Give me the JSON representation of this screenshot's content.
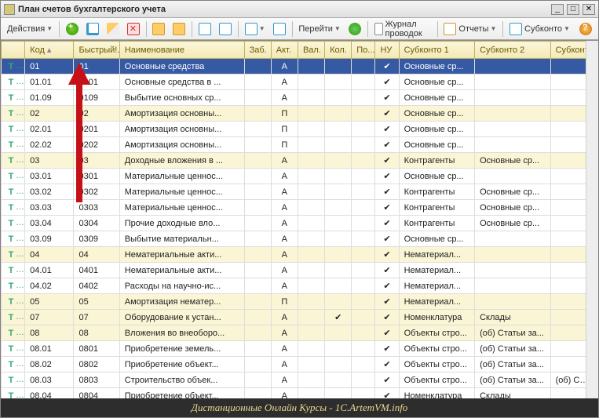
{
  "window": {
    "title": "План счетов бухгалтерского учета"
  },
  "toolbar": {
    "actions": "Действия",
    "go": "Перейти",
    "journal": "Журнал проводок",
    "reports": "Отчеты",
    "subkonto": "Субконто"
  },
  "columns": {
    "code": "Код",
    "fast": "Быстрый!...",
    "name": "Наименование",
    "zab": "Заб.",
    "akt": "Акт.",
    "val": "Вал.",
    "kol": "Кол.",
    "po": "По...",
    "nu": "НУ",
    "s1": "Субконто 1",
    "s2": "Субконто 2",
    "s3": "Субконто"
  },
  "rows": [
    {
      "lvl": 0,
      "sel": true,
      "code": "01",
      "fast": "01",
      "name": "Основные средства",
      "akt": "А",
      "nu": true,
      "s1": "Основные ср...",
      "s2": "",
      "s3": ""
    },
    {
      "lvl": 1,
      "code": "01.01",
      "fast": "0101",
      "name": "Основные средства в ...",
      "akt": "А",
      "nu": true,
      "s1": "Основные ср...",
      "s2": "",
      "s3": ""
    },
    {
      "lvl": 1,
      "code": "01.09",
      "fast": "0109",
      "name": "Выбытие основных ср...",
      "akt": "А",
      "nu": true,
      "s1": "Основные ср...",
      "s2": "",
      "s3": ""
    },
    {
      "lvl": 0,
      "code": "02",
      "fast": "02",
      "name": "Амортизация основны...",
      "akt": "П",
      "nu": true,
      "s1": "Основные ср...",
      "s2": "",
      "s3": ""
    },
    {
      "lvl": 1,
      "code": "02.01",
      "fast": "0201",
      "name": "Амортизация основны...",
      "akt": "П",
      "nu": true,
      "s1": "Основные ср...",
      "s2": "",
      "s3": ""
    },
    {
      "lvl": 1,
      "code": "02.02",
      "fast": "0202",
      "name": "Амортизация основны...",
      "akt": "П",
      "nu": true,
      "s1": "Основные ср...",
      "s2": "",
      "s3": ""
    },
    {
      "lvl": 0,
      "code": "03",
      "fast": "03",
      "name": "Доходные вложения в ...",
      "akt": "А",
      "nu": true,
      "s1": "Контрагенты",
      "s2": "Основные ср...",
      "s3": ""
    },
    {
      "lvl": 1,
      "code": "03.01",
      "fast": "0301",
      "name": "Материальные ценнос...",
      "akt": "А",
      "nu": true,
      "s1": "Основные ср...",
      "s2": "",
      "s3": ""
    },
    {
      "lvl": 1,
      "code": "03.02",
      "fast": "0302",
      "name": "Материальные ценнос...",
      "akt": "А",
      "nu": true,
      "s1": "Контрагенты",
      "s2": "Основные ср...",
      "s3": ""
    },
    {
      "lvl": 1,
      "code": "03.03",
      "fast": "0303",
      "name": "Материальные ценнос...",
      "akt": "А",
      "nu": true,
      "s1": "Контрагенты",
      "s2": "Основные ср...",
      "s3": ""
    },
    {
      "lvl": 1,
      "code": "03.04",
      "fast": "0304",
      "name": "Прочие доходные вло...",
      "akt": "А",
      "nu": true,
      "s1": "Контрагенты",
      "s2": "Основные ср...",
      "s3": ""
    },
    {
      "lvl": 1,
      "code": "03.09",
      "fast": "0309",
      "name": "Выбытие материальн...",
      "akt": "А",
      "nu": true,
      "s1": "Основные ср...",
      "s2": "",
      "s3": ""
    },
    {
      "lvl": 0,
      "code": "04",
      "fast": "04",
      "name": "Нематериальные акти...",
      "akt": "А",
      "nu": true,
      "s1": "Нематериал...",
      "s2": "",
      "s3": ""
    },
    {
      "lvl": 1,
      "code": "04.01",
      "fast": "0401",
      "name": "Нематериальные акти...",
      "akt": "А",
      "nu": true,
      "s1": "Нематериал...",
      "s2": "",
      "s3": ""
    },
    {
      "lvl": 1,
      "code": "04.02",
      "fast": "0402",
      "name": "Расходы на научно-ис...",
      "akt": "А",
      "nu": true,
      "s1": "Нематериал...",
      "s2": "",
      "s3": ""
    },
    {
      "lvl": 0,
      "code": "05",
      "fast": "05",
      "name": "Амортизация нематер...",
      "akt": "П",
      "nu": true,
      "s1": "Нематериал...",
      "s2": "",
      "s3": ""
    },
    {
      "lvl": 0,
      "code": "07",
      "fast": "07",
      "name": "Оборудование к устан...",
      "akt": "А",
      "kol": true,
      "nu": true,
      "s1": "Номенклатура",
      "s2": "Склады",
      "s3": ""
    },
    {
      "lvl": 0,
      "code": "08",
      "fast": "08",
      "name": "Вложения во внеоборо...",
      "akt": "А",
      "nu": true,
      "s1": "Объекты стро...",
      "s2": "(об) Статьи за...",
      "s3": ""
    },
    {
      "lvl": 1,
      "code": "08.01",
      "fast": "0801",
      "name": "Приобретение земель...",
      "akt": "А",
      "nu": true,
      "s1": "Объекты стро...",
      "s2": "(об) Статьи за...",
      "s3": ""
    },
    {
      "lvl": 1,
      "code": "08.02",
      "fast": "0802",
      "name": "Приобретение объект...",
      "akt": "А",
      "nu": true,
      "s1": "Объекты стро...",
      "s2": "(об) Статьи за...",
      "s3": ""
    },
    {
      "lvl": 1,
      "code": "08.03",
      "fast": "0803",
      "name": "Строительство объек...",
      "akt": "А",
      "nu": true,
      "s1": "Объекты стро...",
      "s2": "(об) Статьи за...",
      "s3": "(об) Спос"
    },
    {
      "lvl": 1,
      "code": "08.04",
      "fast": "0804",
      "name": "Приобретение объект...",
      "akt": "А",
      "nu": true,
      "s1": "Номенклатура",
      "s2": "Склады",
      "s3": ""
    }
  ],
  "footer": "Дистанционные Онлайн Курсы - 1C.ArtemVM.info"
}
